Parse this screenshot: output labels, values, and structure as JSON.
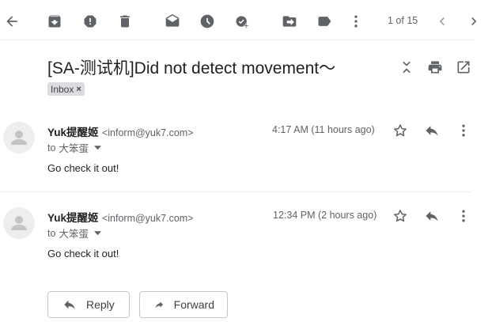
{
  "toolbar": {
    "icons": [
      "back-arrow-icon",
      "archive-icon",
      "report-spam-icon",
      "delete-icon",
      "mark-unread-icon",
      "snooze-icon",
      "add-task-icon",
      "move-to-icon",
      "label-icon",
      "more-vertical-icon"
    ],
    "pager_text": "1 of 15"
  },
  "subject": {
    "title": "[SA-测试机]Did not detect movement～",
    "label": "Inbox",
    "label_remove": "×"
  },
  "messages": [
    {
      "sender_name": "Yuk提醒姬",
      "sender_email": "<inform@yuk7.com>",
      "to_prefix": "to",
      "to_name": "大笨蛋",
      "timestamp": "4:17 AM (11 hours ago)",
      "body": "Go check it out!"
    },
    {
      "sender_name": "Yuk提醒姬",
      "sender_email": "<inform@yuk7.com>",
      "to_prefix": "to",
      "to_name": "大笨蛋",
      "timestamp": "12:34 PM (2 hours ago)",
      "body": "Go check it out!"
    }
  ],
  "actions": {
    "reply_label": "Reply",
    "forward_label": "Forward"
  },
  "colors": {
    "icon": "#5f6368",
    "text": "#202124",
    "chip": "#dadce0"
  }
}
